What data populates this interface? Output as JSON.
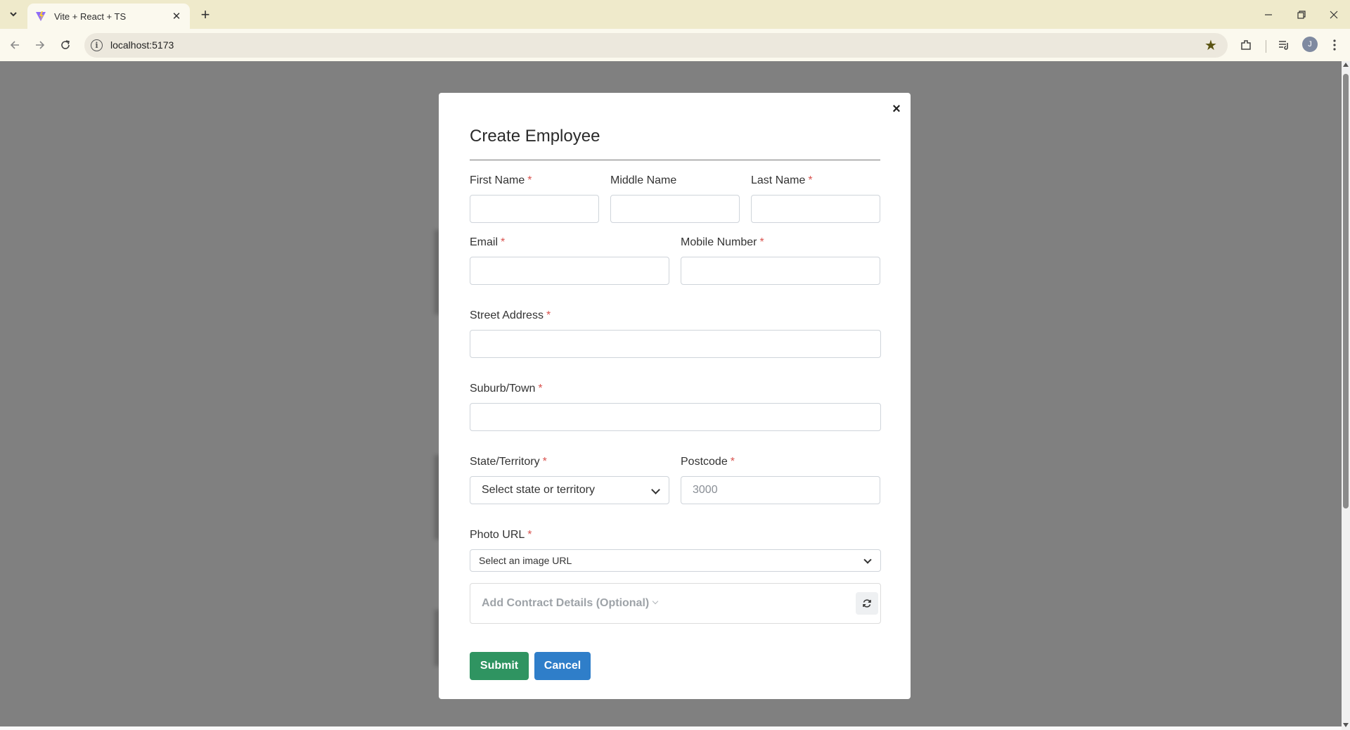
{
  "browser": {
    "tab_title": "Vite + React + TS",
    "url": "localhost:5173",
    "profile_initial": "J"
  },
  "modal": {
    "title": "Create Employee",
    "close_glyph": "×",
    "fields": {
      "first_name": {
        "label": "First Name",
        "required": "*",
        "value": ""
      },
      "middle_name": {
        "label": "Middle Name",
        "value": ""
      },
      "last_name": {
        "label": "Last Name",
        "required": "*",
        "value": ""
      },
      "email": {
        "label": "Email",
        "required": "*",
        "value": ""
      },
      "mobile": {
        "label": "Mobile Number",
        "required": "*",
        "value": ""
      },
      "street": {
        "label": "Street Address",
        "required": "*",
        "value": ""
      },
      "suburb": {
        "label": "Suburb/Town",
        "required": "*",
        "value": ""
      },
      "state": {
        "label": "State/Territory",
        "required": "*",
        "selected": "Select state or territory"
      },
      "postcode": {
        "label": "Postcode",
        "required": "*",
        "placeholder": "3000"
      },
      "photo_url": {
        "label": "Photo URL",
        "required": "*",
        "selected": "Select an image URL"
      }
    },
    "contract": {
      "label": "Add Contract Details (Optional)"
    },
    "buttons": {
      "submit": "Submit",
      "cancel": "Cancel"
    }
  },
  "colors": {
    "submit_bg": "#2f9461",
    "cancel_bg": "#2f7ec9",
    "required_star": "#d9534f",
    "overlay": "#808080"
  }
}
